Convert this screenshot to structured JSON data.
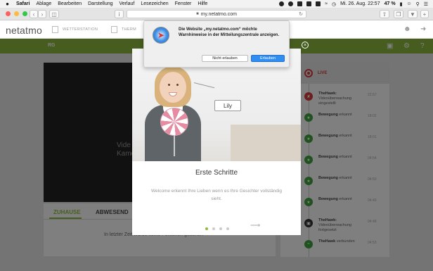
{
  "menubar": {
    "app": "Safari",
    "items": [
      "Ablage",
      "Bearbeiten",
      "Darstellung",
      "Verlauf",
      "Lesezeichen",
      "Fenster",
      "Hilfe"
    ],
    "battery": "47 %",
    "datetime": "Mi. 26. Aug.  22:57"
  },
  "browser": {
    "url": "my.netatmo.com",
    "back_icon": "chevron-left-icon",
    "forward_icon": "chevron-right-icon"
  },
  "site": {
    "logo": "netatmo",
    "nav": [
      "WETTERSTATION",
      "THERM"
    ],
    "home_name": "RG"
  },
  "tabs": {
    "home": "ZUHAUSE",
    "away": "ABWESEND",
    "message": "In letzter Zeit wurde keine Personen gesehen"
  },
  "video": {
    "line1": "Vide",
    "line2": "Kame"
  },
  "timeline": {
    "live": "LIVE",
    "events": [
      {
        "title": "TheHawk:",
        "text": "Videoüberwachung eingestellt",
        "time": "22:57",
        "color": "#d93a3a",
        "icon": "shield-off-icon"
      },
      {
        "title": "Bewegung",
        "text": "erkannt",
        "time": "18:02",
        "color": "#3fa53f",
        "icon": "motion-icon"
      },
      {
        "title": "Bewegung",
        "text": "erkannt",
        "time": "18:01",
        "color": "#3fa53f",
        "icon": "motion-icon"
      },
      {
        "title": "Bewegung",
        "text": "erkannt",
        "time": "04:54",
        "color": "#3fa53f",
        "icon": "motion-icon"
      },
      {
        "title": "Bewegung",
        "text": "erkannt",
        "time": "04:50",
        "color": "#3fa53f",
        "icon": "motion-icon"
      },
      {
        "title": "Bewegung",
        "text": "erkannt",
        "time": "04:49",
        "color": "#3fa53f",
        "icon": "motion-icon"
      },
      {
        "title": "TheHawk:",
        "text": "Videoüberwachung fortgesetzt",
        "time": "04:48",
        "color": "#333333",
        "icon": "camera-icon"
      },
      {
        "title": "TheHawk",
        "text": "verbunden",
        "time": "04:53",
        "color": "#3fa53f",
        "icon": "wifi-icon"
      }
    ]
  },
  "modal": {
    "tag": "Lily",
    "title": "Erste Schritte",
    "text": "Welcome erkennt Ihre Lieben wenn es Ihre Gesichter vollständig sieht.",
    "pages": 4,
    "current_page": 1
  },
  "prompt": {
    "message": "Die Website „my.netatmo.com“ möchte Warnhinweise in der Mitteilungszentrale anzeigen.",
    "deny": "Nicht erlauben",
    "allow": "Erlauben"
  },
  "colors": {
    "brand_green": "#8fbb3f",
    "live_red": "#d93a3a",
    "allow_blue": "#2f8ef0"
  }
}
